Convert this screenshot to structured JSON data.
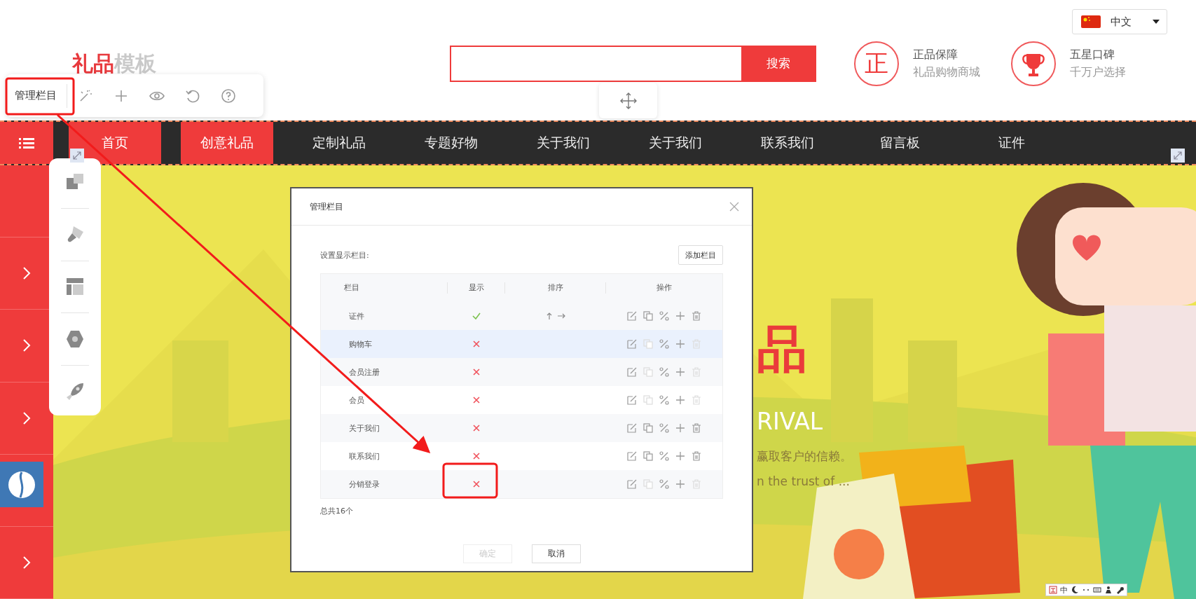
{
  "language_selector": {
    "label": "中文"
  },
  "logo": {
    "primary": "礼品",
    "secondary": "模板"
  },
  "search": {
    "button": "搜索"
  },
  "badges": [
    {
      "kind": "seal",
      "glyph": "正",
      "title": "正品保障",
      "subtitle": "礼品购物商城"
    },
    {
      "kind": "trophy",
      "title": "五星口碑",
      "subtitle": "千万户选择"
    }
  ],
  "editor_toolbar": {
    "manage_button": "管理栏目"
  },
  "nav": {
    "items": [
      {
        "label": "首页",
        "active": true
      },
      {
        "label": "创意礼品",
        "active": true
      },
      {
        "label": "定制礼品",
        "active": false
      },
      {
        "label": "专题好物",
        "active": false
      },
      {
        "label": "关于我们",
        "active": false
      },
      {
        "label": "关于我们",
        "active": false
      },
      {
        "label": "联系我们",
        "active": false
      },
      {
        "label": "留言板",
        "active": false
      },
      {
        "label": "证件",
        "active": false
      }
    ]
  },
  "banner": {
    "title_glyph": "品",
    "subtitle_en": "RIVAL",
    "tagline": "赢取客户的信赖。",
    "tagline_en": "n the trust of ..."
  },
  "dialog": {
    "title": "管理栏目",
    "section_label": "设置显示栏目:",
    "add_button": "添加栏目",
    "columns": [
      "栏目",
      "显示",
      "排序",
      "操作"
    ],
    "rows": [
      {
        "name": "证件",
        "shown": true,
        "sortable": true,
        "copy_enabled": true,
        "delete_enabled": true,
        "highlighted": false
      },
      {
        "name": "购物车",
        "shown": false,
        "sortable": false,
        "copy_enabled": false,
        "delete_enabled": false,
        "highlighted": true
      },
      {
        "name": "会员注册",
        "shown": false,
        "sortable": false,
        "copy_enabled": false,
        "delete_enabled": false,
        "highlighted": false
      },
      {
        "name": "会员",
        "shown": false,
        "sortable": false,
        "copy_enabled": false,
        "delete_enabled": false,
        "highlighted": false
      },
      {
        "name": "关于我们",
        "shown": false,
        "sortable": false,
        "copy_enabled": true,
        "delete_enabled": true,
        "highlighted": false
      },
      {
        "name": "联系我们",
        "shown": false,
        "sortable": false,
        "copy_enabled": true,
        "delete_enabled": true,
        "highlighted": false
      },
      {
        "name": "分销登录",
        "shown": false,
        "sortable": false,
        "copy_enabled": false,
        "delete_enabled": false,
        "highlighted": false
      }
    ],
    "total": "总共16个",
    "buttons": [
      {
        "label": "确定",
        "disabled": true
      },
      {
        "label": "取消",
        "disabled": false
      }
    ]
  },
  "mini_toolbar": {
    "label": "中"
  }
}
